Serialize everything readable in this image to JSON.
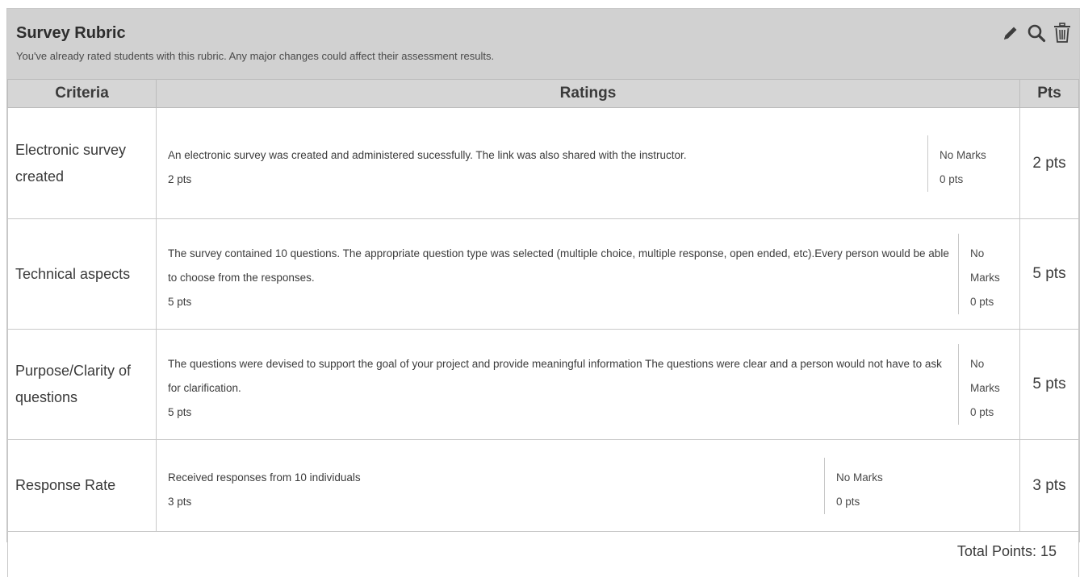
{
  "header": {
    "title": "Survey Rubric",
    "warning": "You've already rated students with this rubric. Any major changes could affect their assessment results.",
    "actions": [
      {
        "icon": "pencil-icon"
      },
      {
        "icon": "search-icon"
      },
      {
        "icon": "trash-icon"
      }
    ]
  },
  "columns": {
    "criteria": "Criteria",
    "ratings": "Ratings",
    "pts": "Pts"
  },
  "rows": [
    {
      "criterion": "Electronic survey created",
      "ratings": [
        {
          "description": "An electronic survey was created and administered sucessfully. The link was also shared with the instructor.",
          "points": "2 pts"
        },
        {
          "description": "No Marks",
          "points": "0 pts"
        }
      ],
      "pts": "2 pts"
    },
    {
      "criterion": "Technical aspects",
      "ratings": [
        {
          "description": "The survey contained 10 questions. The appropriate question type was selected (multiple choice, multiple response, open ended, etc).Every person would be able to choose from the responses.",
          "points": "5 pts"
        },
        {
          "description": "No Marks",
          "points": "0 pts"
        }
      ],
      "pts": "5 pts"
    },
    {
      "criterion": "Purpose/Clarity of questions",
      "ratings": [
        {
          "description": "The questions were devised to support the goal of your project and provide meaningful information The questions were clear and a person would not have to ask for clarification.",
          "points": "5 pts"
        },
        {
          "description": "No Marks",
          "points": "0 pts"
        }
      ],
      "pts": "5 pts"
    },
    {
      "criterion": "Response Rate",
      "ratings": [
        {
          "description": "Received responses from 10 individuals",
          "points": "3 pts"
        },
        {
          "description": "No Marks",
          "points": "0 pts"
        }
      ],
      "pts": "3 pts"
    }
  ],
  "total": "Total Points: 15"
}
